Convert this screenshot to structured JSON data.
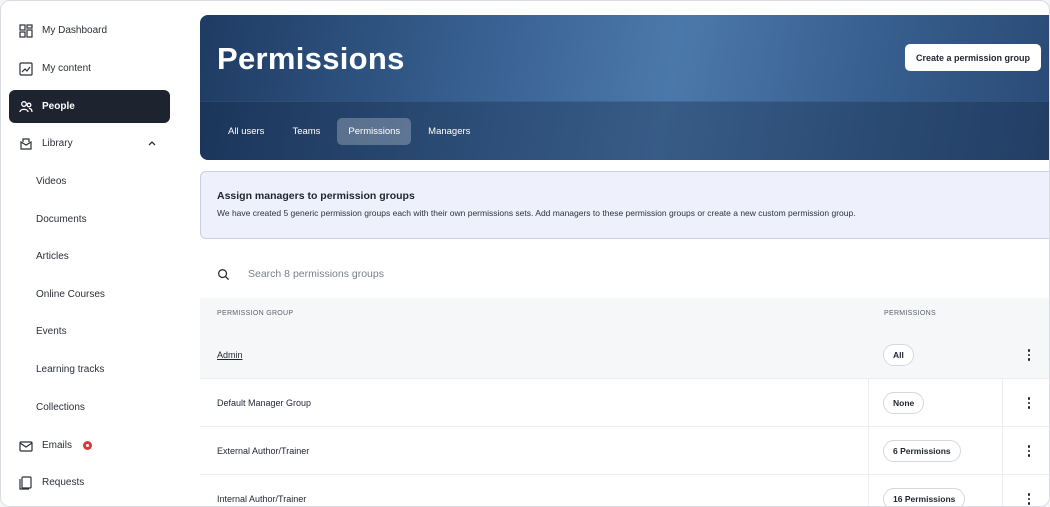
{
  "sidebar": {
    "items": [
      {
        "label": "My Dashboard",
        "icon": "dashboard-icon"
      },
      {
        "label": "My content",
        "icon": "content-icon"
      },
      {
        "label": "People",
        "icon": "people-icon",
        "active": true
      },
      {
        "label": "Library",
        "icon": "library-icon",
        "expanded": true
      },
      {
        "label": "Videos"
      },
      {
        "label": "Documents"
      },
      {
        "label": "Articles"
      },
      {
        "label": "Online Courses"
      },
      {
        "label": "Events"
      },
      {
        "label": "Learning tracks"
      },
      {
        "label": "Collections"
      },
      {
        "label": "Emails",
        "icon": "mail-icon",
        "badge_color": "#d23b3b"
      },
      {
        "label": "Requests",
        "icon": "requests-icon"
      }
    ]
  },
  "header": {
    "title": "Permissions",
    "create_button": "Create a permission group",
    "tabs": [
      {
        "label": "All users"
      },
      {
        "label": "Teams"
      },
      {
        "label": "Permissions",
        "active": true
      },
      {
        "label": "Managers"
      }
    ]
  },
  "info": {
    "title": "Assign managers to permission groups",
    "text": "We have created 5 generic permission groups each with their own permissions sets. Add managers to these permission groups or create a new custom permission group."
  },
  "search": {
    "placeholder": "Search 8 permissions groups"
  },
  "table": {
    "headers": {
      "group": "PERMISSION GROUP",
      "permissions": "PERMISSIONS"
    },
    "rows": [
      {
        "name": "Admin",
        "permissions": "All"
      },
      {
        "name": "Default Manager Group",
        "permissions": "None"
      },
      {
        "name": "External Author/Trainer",
        "permissions": "6 Permissions"
      },
      {
        "name": "Internal Author/Trainer",
        "permissions": "16 Permissions"
      }
    ]
  },
  "colors": {
    "accent_dark": "#1e2330",
    "hero_blue": "#3a6394",
    "info_bg": "#eef0fb",
    "badge_red": "#d23b3b"
  }
}
